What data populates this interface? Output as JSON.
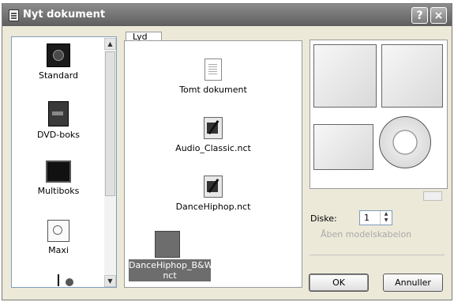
{
  "window": {
    "title": "Nyt dokument",
    "help": "?",
    "close": "×"
  },
  "left_list": {
    "items": [
      {
        "label": "Standard",
        "icon": "standard-case-icon"
      },
      {
        "label": "DVD-boks",
        "icon": "dvd-box-icon"
      },
      {
        "label": "Multiboks",
        "icon": "multibox-icon"
      },
      {
        "label": "Maxi",
        "icon": "maxi-icon"
      },
      {
        "label": "",
        "icon": "case-icon"
      }
    ],
    "scroll_up": "▲",
    "scroll_down": "▼"
  },
  "tab": {
    "label": "Lyd"
  },
  "templates": {
    "items": [
      {
        "label": "Tomt dokument",
        "icon": "blank-document-icon"
      },
      {
        "label": "Audio_Classic.nct",
        "icon": "template-icon"
      },
      {
        "label": "DanceHiphop.nct",
        "icon": "template-icon"
      },
      {
        "label": "DanceHiphop_B&W.\nnct",
        "icon": "template-icon",
        "selected": true
      }
    ]
  },
  "preview": {
    "icon": "cd-label-preview"
  },
  "disks": {
    "label": "Diske:",
    "value": "1",
    "spin": "▲▼"
  },
  "open_template_folder": "Åben modelskabelon",
  "buttons": {
    "ok": "OK",
    "cancel": "Annuller"
  }
}
